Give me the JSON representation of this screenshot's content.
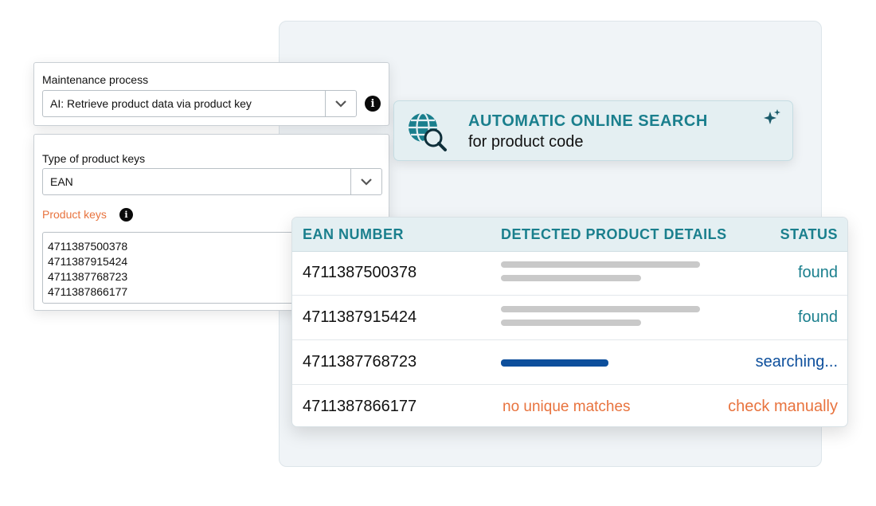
{
  "form": {
    "maintenance_label": "Maintenance process",
    "maintenance_value": "AI: Retrieve product data via product key",
    "key_type_label": "Type of product keys",
    "key_type_value": "EAN",
    "product_keys_label": "Product keys",
    "product_keys": [
      "4711387500378",
      "4711387915424",
      "4711387768723",
      "4711387866177"
    ]
  },
  "search_card": {
    "title": "AUTOMATIC ONLINE SEARCH",
    "subtitle": "for product code",
    "icon": "globe-search-icon",
    "sparkle_icon": "sparkle-icon"
  },
  "table": {
    "headers": [
      "EAN NUMBER",
      "DETECTED PRODUCT DETAILS",
      "STATUS"
    ],
    "rows": [
      {
        "ean": "4711387500378",
        "detail": "",
        "status": "found"
      },
      {
        "ean": "4711387915424",
        "detail": "",
        "status": "found"
      },
      {
        "ean": "4711387768723",
        "detail": "",
        "status": "searching..."
      },
      {
        "ean": "4711387866177",
        "detail": "no unique matches",
        "status": "check manually"
      }
    ]
  },
  "colors": {
    "accent_teal": "#1a7f8d",
    "found": "#1a7f8d",
    "searching": "#0d4f9c",
    "warning": "#e8733e"
  }
}
